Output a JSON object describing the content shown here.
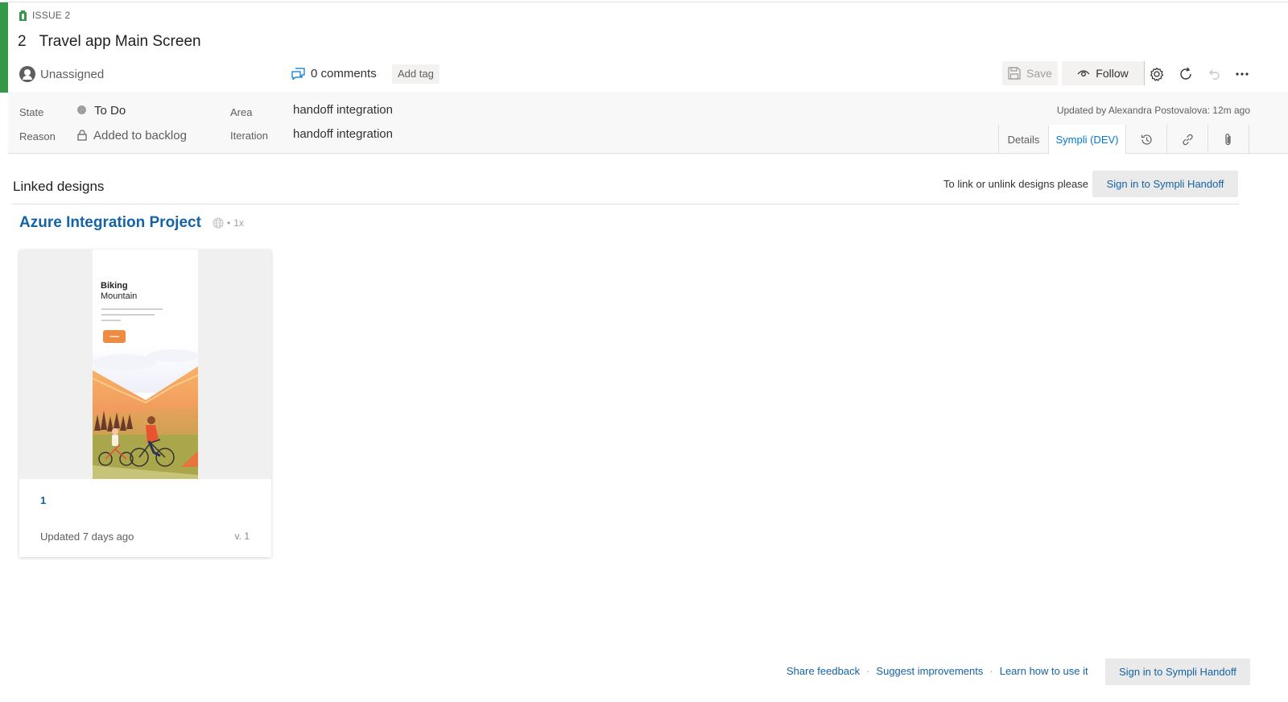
{
  "work_item": {
    "type_label": "ISSUE 2",
    "id": "2",
    "title": "Travel app Main Screen",
    "assignee": "Unassigned",
    "comments": "0 comments",
    "add_tag": "Add tag"
  },
  "toolbar": {
    "save_label": "Save",
    "follow_label": "Follow",
    "icons": [
      "settings-icon",
      "refresh-icon",
      "undo-icon",
      "more-icon"
    ]
  },
  "fields": {
    "state_label": "State",
    "state_value": "To Do",
    "reason_label": "Reason",
    "reason_value": "Added to backlog",
    "area_label": "Area",
    "area_value": "handoff integration",
    "iteration_label": "Iteration",
    "iteration_value": "handoff integration",
    "updated_by": "Updated by Alexandra Postovalova: 12m ago",
    "state_color": "#a19f9d"
  },
  "tabs": [
    {
      "label": "Details",
      "active": false
    },
    {
      "label": "Sympli (DEV)",
      "active": true
    },
    {
      "icon": "history-icon"
    },
    {
      "icon": "link-icon"
    },
    {
      "icon": "attachment-icon"
    }
  ],
  "linked": {
    "section_title": "Linked designs",
    "hint": "To link or unlink designs please",
    "signin": "Sign in to Sympli Handoff"
  },
  "project": {
    "name": "Azure Integration Project",
    "scale": "1x",
    "designs": [
      {
        "name": "1",
        "updated": "Updated 7 days ago",
        "version": "v. 1",
        "preview_heading_1": "Biking",
        "preview_heading_2": "Mountain"
      }
    ]
  },
  "footer": {
    "share_feedback": "Share feedback",
    "suggest": "Suggest improvements",
    "learn": "Learn how to use it",
    "signin": "Sign in to Sympli Handoff"
  },
  "colors": {
    "accent_green": "#339947",
    "link_blue": "#1463a5",
    "active_tab_blue": "#0078d4"
  }
}
